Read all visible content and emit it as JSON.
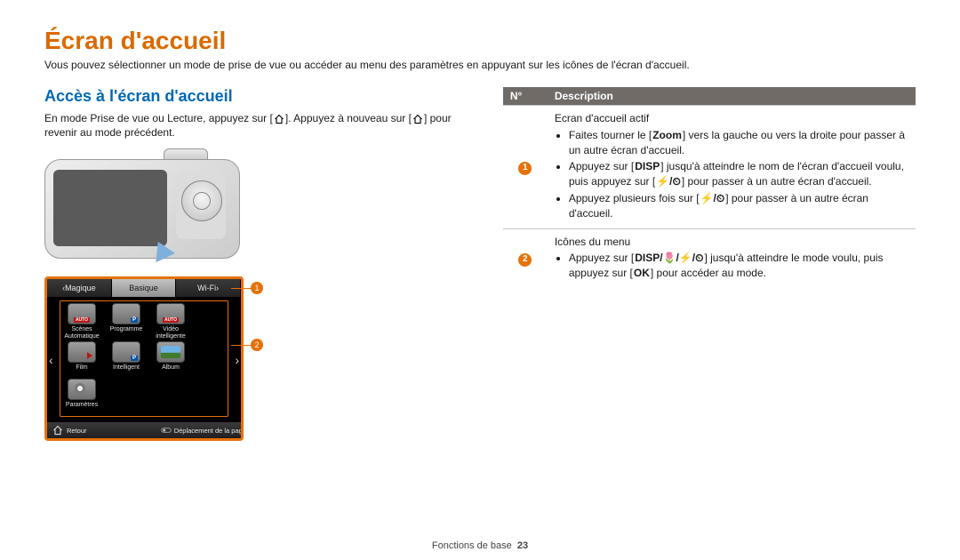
{
  "page": {
    "title": "Écran d'accueil",
    "intro": "Vous pouvez sélectionner un mode de prise de vue ou accéder au menu des paramètres en appuyant sur les icônes de l'écran d'accueil."
  },
  "section": {
    "title": "Accès à l'écran d'accueil",
    "body_pre": "En mode Prise de vue ou Lecture, appuyez sur [",
    "body_mid": "]. Appuyez à nouveau sur [",
    "body_post": "] pour revenir au mode précédent."
  },
  "ui": {
    "tabs": {
      "left": "Magique",
      "center": "Basique",
      "right": "Wi-Fi"
    },
    "apps": [
      {
        "label_line1": "Scènes",
        "label_line2": "Automatique",
        "variant": "auto"
      },
      {
        "label_line1": "Programme",
        "label_line2": "",
        "variant": "p"
      },
      {
        "label_line1": "Vidéo",
        "label_line2": "intelligente",
        "variant": "auto"
      },
      {
        "label_line1": "Film",
        "label_line2": "",
        "variant": "vid"
      },
      {
        "label_line1": "Intelligent",
        "label_line2": "",
        "variant": "p"
      },
      {
        "label_line1": "Album",
        "label_line2": "",
        "variant": "album"
      },
      {
        "label_line1": "Paramètres",
        "label_line2": "",
        "variant": "gear"
      }
    ],
    "footer": {
      "back": "Retour",
      "move": "Déplacement de la page"
    },
    "annot": {
      "a": "1",
      "b": "2"
    }
  },
  "table": {
    "head_no": "N°",
    "head_desc": "Description",
    "rows": [
      {
        "badge": "1",
        "title": "Ecran d'accueil actif",
        "bullets": [
          {
            "pre": "Faites tourner le [",
            "key1": "Zoom",
            "post": "] vers la gauche ou vers la droite pour passer à un autre écran d'accueil."
          },
          {
            "pre": "Appuyez sur [",
            "key1": "DISP",
            "mid1": "] jusqu'à atteindre le nom de l'écran d'accueil voulu, puis appuyez sur [",
            "key2": "⚡/⏲",
            "post": "] pour passer à un autre écran d'accueil."
          },
          {
            "pre": "Appuyez plusieurs fois sur [",
            "key1": "⚡/⏲",
            "post": "] pour passer à un autre écran d'accueil."
          }
        ]
      },
      {
        "badge": "2",
        "title": "Icônes du menu",
        "bullets": [
          {
            "pre": "Appuyez sur [",
            "key1": "DISP/🌷/⚡/⏲",
            "mid1": "] jusqu'à atteindre le mode voulu, puis appuyez sur [",
            "key2": "OK",
            "post": "] pour accéder au mode."
          }
        ]
      }
    ]
  },
  "footer": {
    "section": "Fonctions de base",
    "page": "23"
  }
}
